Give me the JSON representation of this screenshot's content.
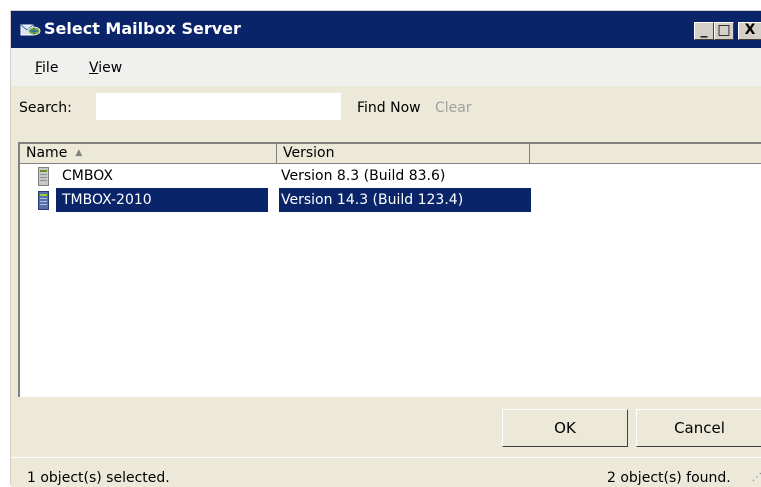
{
  "window": {
    "title": "Select Mailbox Server",
    "controls": {
      "minimize": "_",
      "maximize": "□",
      "close": "X"
    }
  },
  "menubar": {
    "items": [
      {
        "label": "File",
        "accel": "F",
        "rest": "ile"
      },
      {
        "label": "View",
        "accel": "V",
        "rest": "iew"
      }
    ]
  },
  "search": {
    "label": "Search:",
    "value": "",
    "find_now": "Find Now",
    "clear": "Clear"
  },
  "list": {
    "columns": [
      {
        "label": "Name",
        "sort": "ascending"
      },
      {
        "label": "Version"
      },
      {
        "label": ""
      }
    ],
    "rows": [
      {
        "name": "CMBOX",
        "version": "Version 8.3 (Build 83.6)",
        "icon": "server-icon",
        "selected": false
      },
      {
        "name": "TMBOX-2010",
        "version": "Version 14.3 (Build 123.4)",
        "icon": "server-icon",
        "selected": true
      }
    ]
  },
  "buttons": {
    "ok": "OK",
    "cancel": "Cancel"
  },
  "status": {
    "selected": "1 object(s) selected.",
    "found": "2 object(s) found."
  },
  "colors": {
    "title_bar": "#0a246a",
    "selection": "#0a246a",
    "dialog_face": "#ece9d8"
  }
}
